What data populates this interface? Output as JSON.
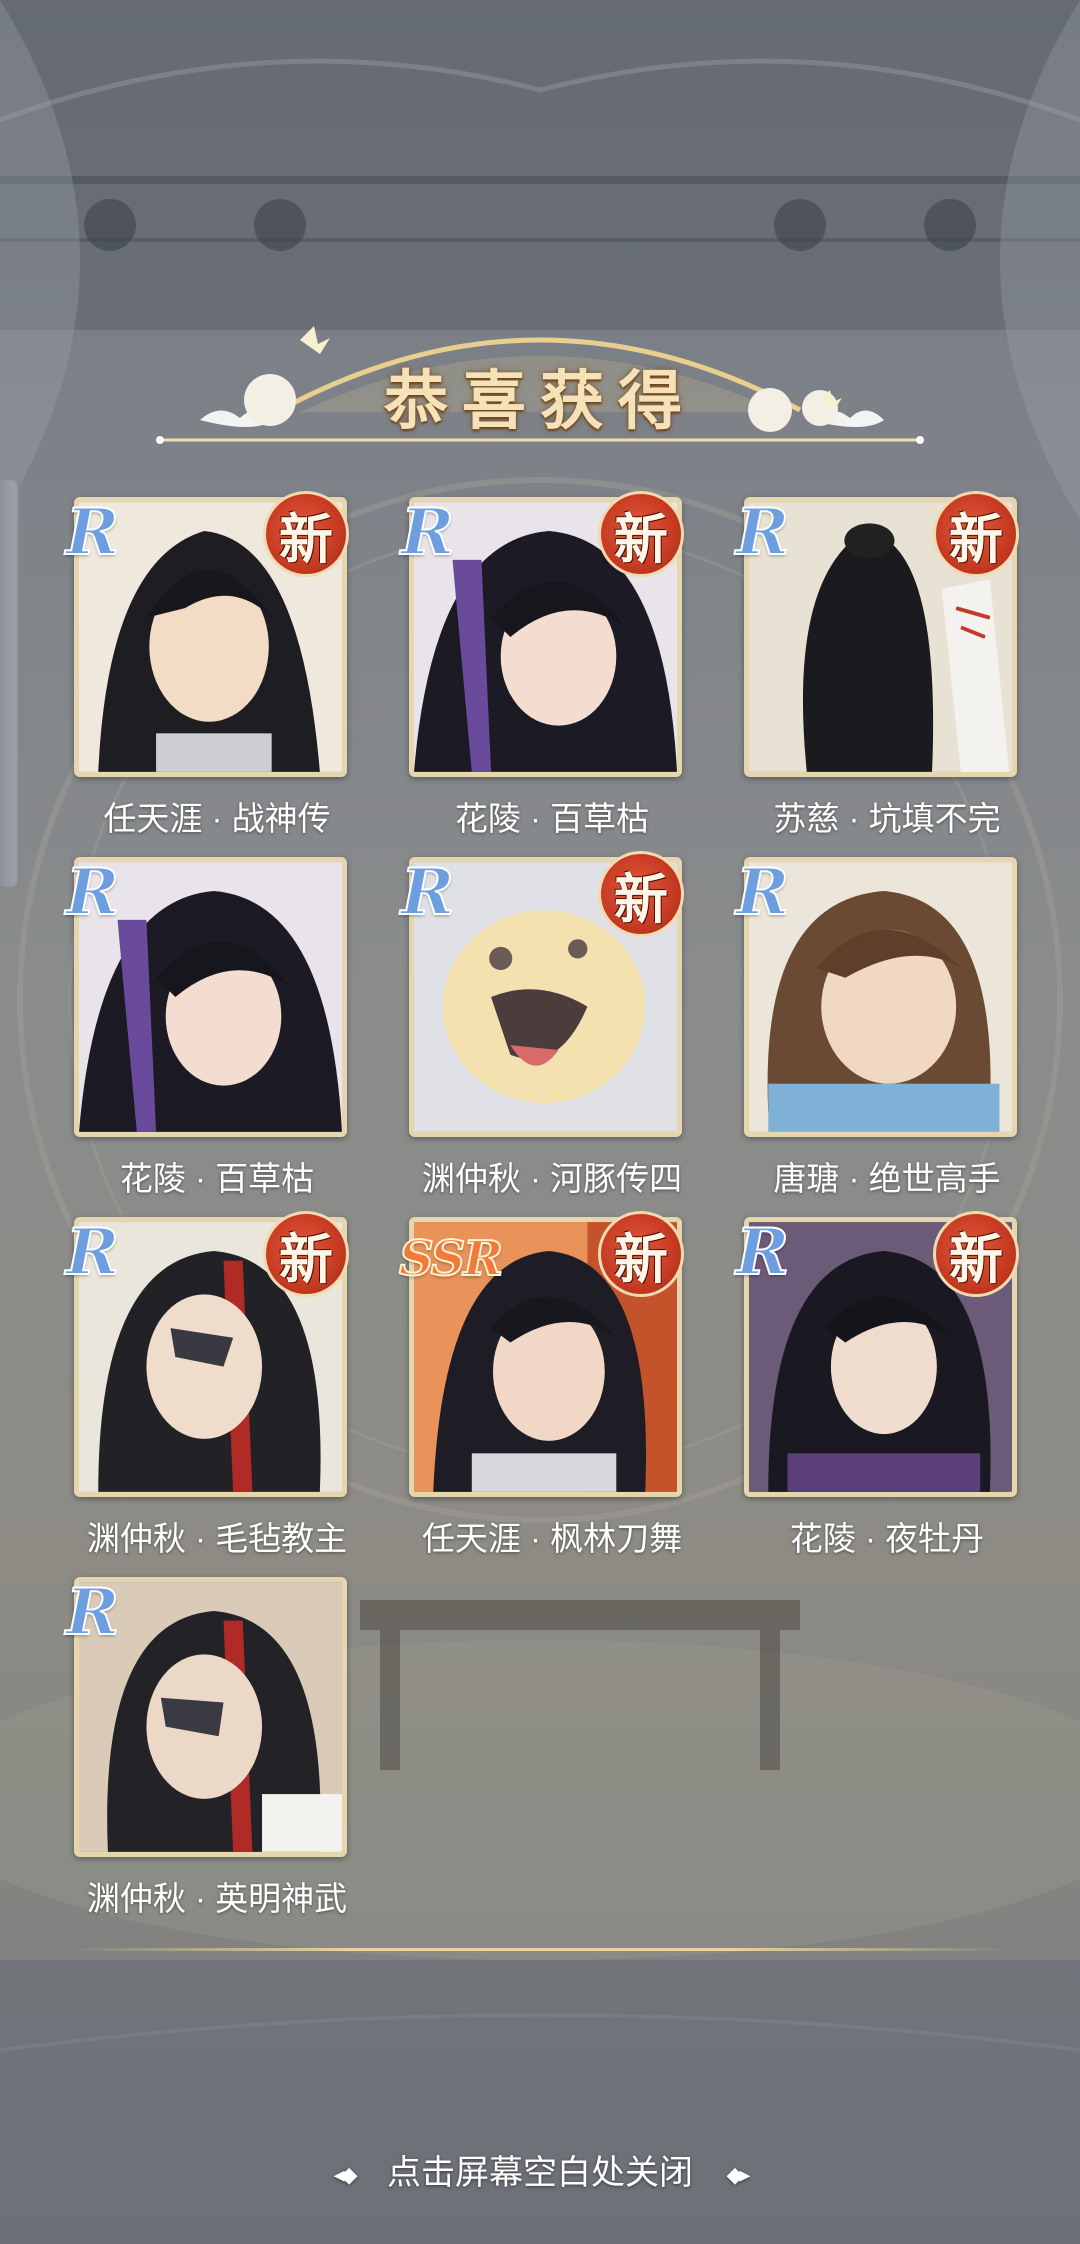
{
  "header": {
    "title": "恭喜获得"
  },
  "cards": [
    {
      "name": "任天涯 · 战神传",
      "rarity": "R",
      "new_label": "新",
      "is_new": true
    },
    {
      "name": "花陵 · 百草枯",
      "rarity": "R",
      "new_label": "新",
      "is_new": true
    },
    {
      "name": "苏慈 · 坑填不完",
      "rarity": "R",
      "new_label": "新",
      "is_new": true
    },
    {
      "name": "花陵 · 百草枯",
      "rarity": "R",
      "new_label": "",
      "is_new": false
    },
    {
      "name": "渊仲秋 · 河豚传四",
      "rarity": "R",
      "new_label": "新",
      "is_new": true
    },
    {
      "name": "唐瑭 · 绝世高手",
      "rarity": "R",
      "new_label": "",
      "is_new": false
    },
    {
      "name": "渊仲秋 · 毛毡教主",
      "rarity": "R",
      "new_label": "新",
      "is_new": true
    },
    {
      "name": "任天涯 · 枫林刀舞",
      "rarity": "SSR",
      "new_label": "新",
      "is_new": true
    },
    {
      "name": "花陵 · 夜牡丹",
      "rarity": "R",
      "new_label": "新",
      "is_new": true
    },
    {
      "name": "渊仲秋 · 英明神武",
      "rarity": "R",
      "new_label": "",
      "is_new": false
    }
  ],
  "footer": {
    "close_hint": "点击屏幕空白处关闭"
  },
  "colors": {
    "rarity_r": "#6d9fe0",
    "rarity_ssr": "#f07a3c",
    "new_badge": "#c63a22",
    "frame": "#e6d6ad"
  }
}
